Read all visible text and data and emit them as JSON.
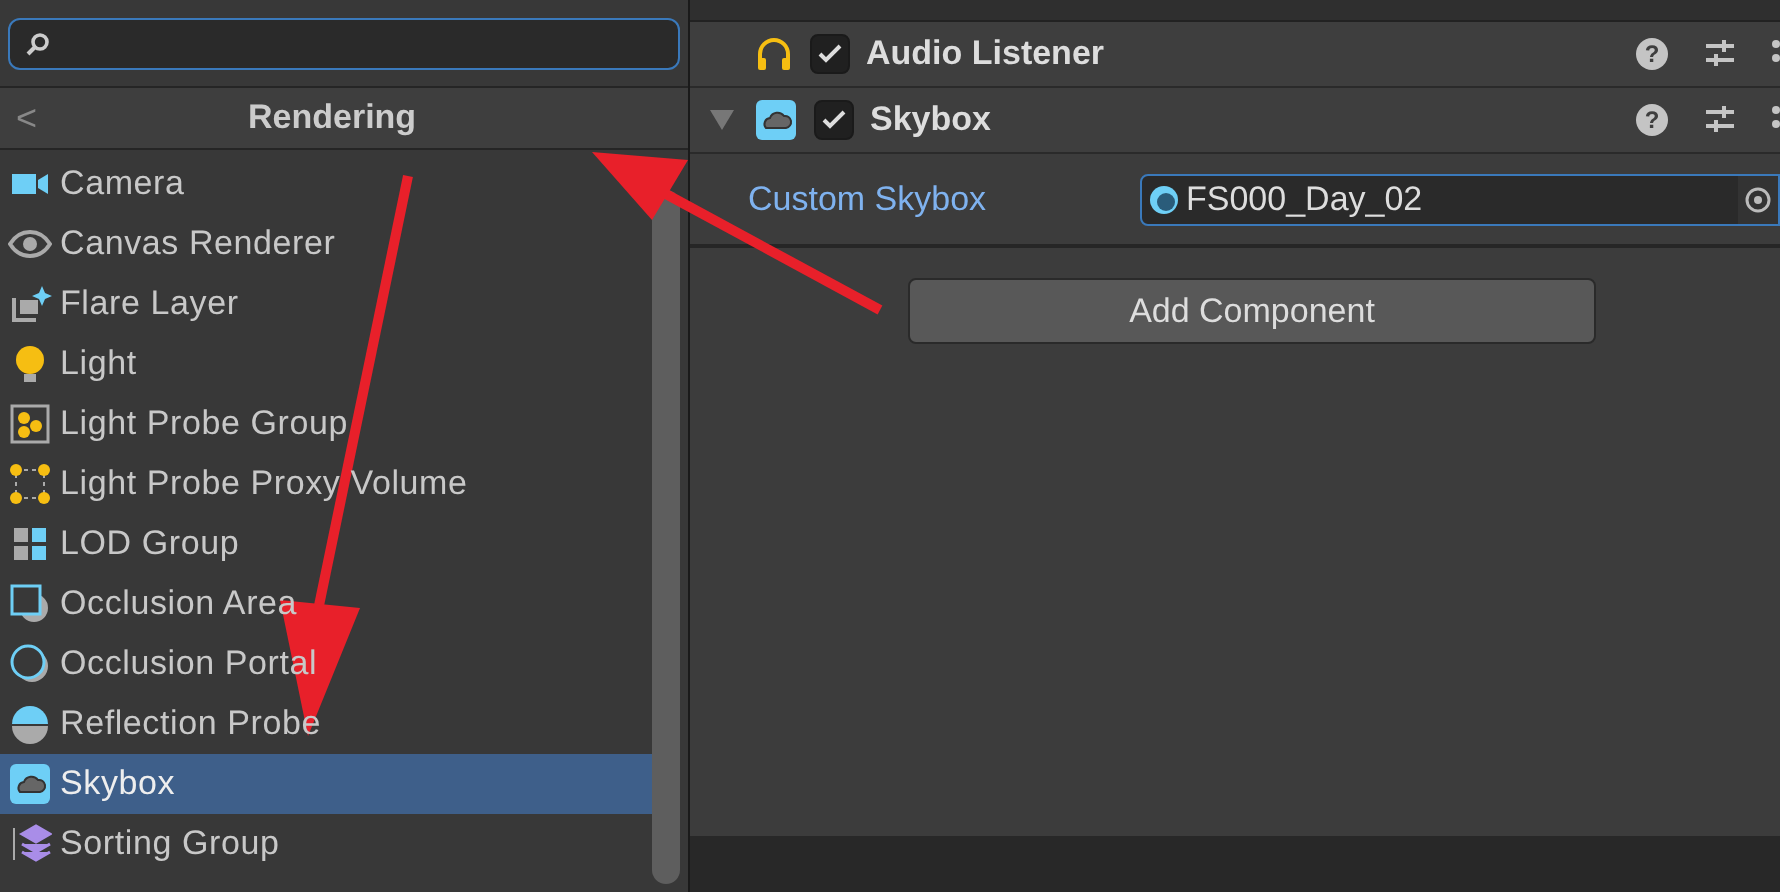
{
  "header": {
    "back": "<",
    "title": "Rendering"
  },
  "items": [
    {
      "label": "Camera",
      "selected": false
    },
    {
      "label": "Canvas Renderer",
      "selected": false
    },
    {
      "label": "Flare Layer",
      "selected": false
    },
    {
      "label": "Light",
      "selected": false
    },
    {
      "label": "Light Probe Group",
      "selected": false
    },
    {
      "label": "Light Probe Proxy Volume",
      "selected": false
    },
    {
      "label": "LOD Group",
      "selected": false
    },
    {
      "label": "Occlusion Area",
      "selected": false
    },
    {
      "label": "Occlusion Portal",
      "selected": false
    },
    {
      "label": "Reflection Probe",
      "selected": false
    },
    {
      "label": "Skybox",
      "selected": true
    },
    {
      "label": "Sorting Group",
      "selected": false
    }
  ],
  "components": [
    {
      "title": "Audio Listener",
      "enabled": true,
      "expanded": false,
      "help": "?"
    },
    {
      "title": "Skybox",
      "enabled": true,
      "expanded": true,
      "help": "?"
    }
  ],
  "property": {
    "label": "Custom Skybox",
    "value": "FS000_Day_02"
  },
  "add_button": "Add Component"
}
